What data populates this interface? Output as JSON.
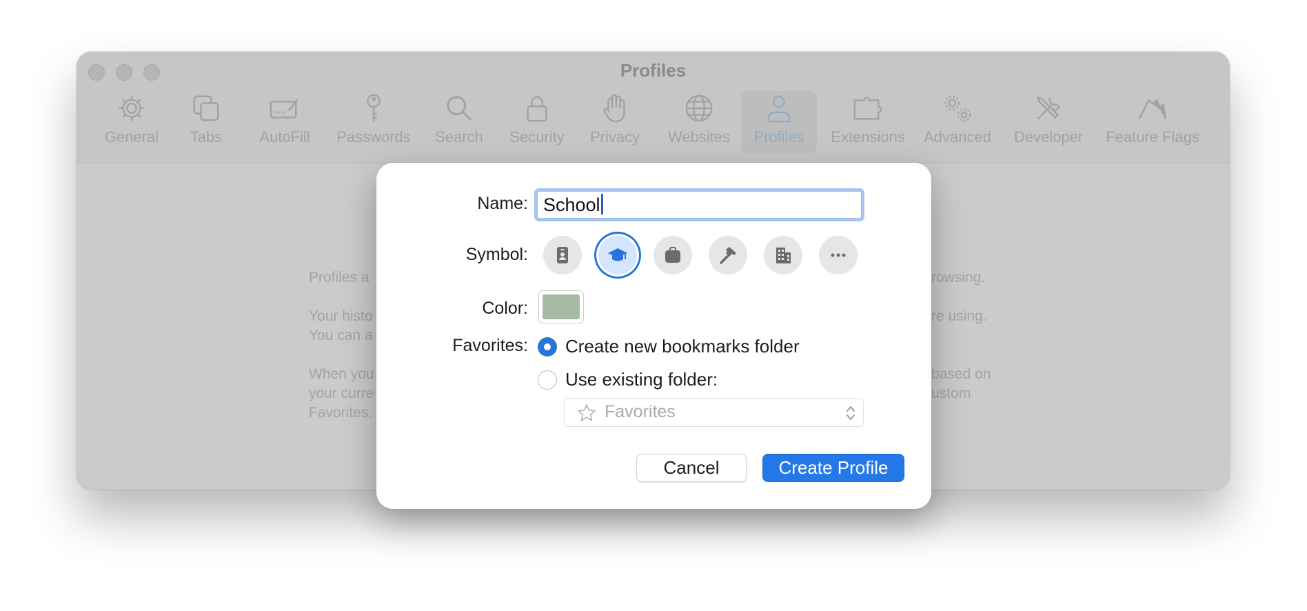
{
  "window": {
    "title": "Profiles",
    "toolbar": [
      {
        "label": "General",
        "icon": "gear-icon"
      },
      {
        "label": "Tabs",
        "icon": "tabs-icon"
      },
      {
        "label": "AutoFill",
        "icon": "autofill-icon"
      },
      {
        "label": "Passwords",
        "icon": "key-icon"
      },
      {
        "label": "Search",
        "icon": "search-icon"
      },
      {
        "label": "Security",
        "icon": "lock-icon"
      },
      {
        "label": "Privacy",
        "icon": "hand-icon"
      },
      {
        "label": "Websites",
        "icon": "globe-icon"
      },
      {
        "label": "Profiles",
        "icon": "person-icon",
        "active": true
      },
      {
        "label": "Extensions",
        "icon": "puzzle-icon"
      },
      {
        "label": "Advanced",
        "icon": "gears-icon"
      },
      {
        "label": "Developer",
        "icon": "tools-icon"
      },
      {
        "label": "Feature Flags",
        "icon": "flags-icon"
      }
    ],
    "background_text": {
      "left": [
        "Profiles a",
        "Your histo",
        "You can a",
        "When you",
        "your curre",
        "Favorites."
      ],
      "right": [
        "rowsing.",
        "re using.",
        "based on",
        "ustom"
      ]
    }
  },
  "dialog": {
    "name_label": "Name:",
    "name_value": "School",
    "symbol_label": "Symbol:",
    "symbols": [
      {
        "icon": "id-badge-icon",
        "selected": false
      },
      {
        "icon": "graduation-cap-icon",
        "selected": true
      },
      {
        "icon": "briefcase-icon",
        "selected": false
      },
      {
        "icon": "hammer-icon",
        "selected": false
      },
      {
        "icon": "building-icon",
        "selected": false
      },
      {
        "icon": "more-icon",
        "selected": false
      }
    ],
    "color_label": "Color:",
    "color_value": "#a6bba3",
    "favorites_label": "Favorites:",
    "option_new": "Create new bookmarks folder",
    "option_new_selected": true,
    "option_existing": "Use existing folder:",
    "option_existing_selected": false,
    "folder_select_value": "Favorites",
    "cancel_label": "Cancel",
    "create_label": "Create Profile"
  },
  "colors": {
    "accent": "#2478e8",
    "window_bg": "#cbcbcb"
  }
}
